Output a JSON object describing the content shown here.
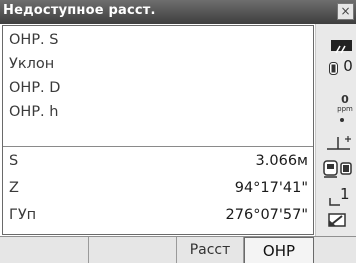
{
  "window": {
    "title": "Недоступное расст.",
    "close_label": "×"
  },
  "fields": [
    {
      "label": "ОНР. S"
    },
    {
      "label": "Уклон"
    },
    {
      "label": "ОНР. D"
    },
    {
      "label": "ОНР. h"
    }
  ],
  "measurements": [
    {
      "label": "S",
      "value": "3.066м"
    },
    {
      "label": "Z",
      "value": "94°17'41\""
    },
    {
      "label": "ГУп",
      "value": "276°07'57\""
    }
  ],
  "status": {
    "prism_constant": "0",
    "ppm_value": "0",
    "ppm_unit": "ppm",
    "face_number": "1"
  },
  "softkeys": [
    "",
    "",
    "Расст",
    "ОНР"
  ]
}
